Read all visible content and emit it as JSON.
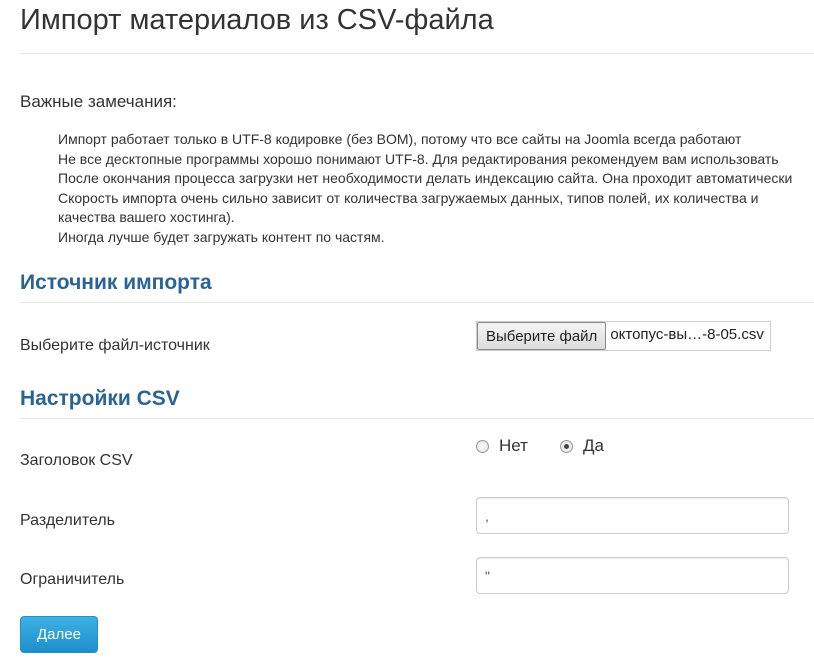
{
  "page": {
    "title": "Импорт материалов из CSV-файла"
  },
  "notes": {
    "heading": "Важные замечания:",
    "items": [
      "Импорт работает только в UTF-8 кодировке (без BOM), потому что все сайты на Joomla всегда работают",
      "Не все десктопные программы хорошо понимают UTF-8. Для редактирования рекомендуем вам использовать",
      "После окончания процесса загрузки нет необходимости делать индексацию сайта. Она проходит автоматически",
      "Скорость импорта очень сильно зависит от количества загружаемых данных, типов полей, их количества и"
    ],
    "item4_line2": "качества вашего хостинга).",
    "item4_line3": "Иногда лучше будет загружать контент по частям."
  },
  "source_section": {
    "title": "Источник импорта",
    "file_label": "Выберите файл-источник",
    "file_button": "Выберите файл",
    "file_name": "октопус-вы…-8-05.csv"
  },
  "csv_section": {
    "title": "Настройки CSV",
    "header_label": "Заголовок CSV",
    "radio_no": "Нет",
    "radio_yes": "Да",
    "selected": "yes",
    "delimiter_label": "Разделитель",
    "delimiter_value": ",",
    "enclosure_label": "Ограничитель",
    "enclosure_value": "\""
  },
  "actions": {
    "next_label": "Далее"
  },
  "colors": {
    "section_title": "#2a6496",
    "primary_button": "#2a9fd6",
    "rule": "#e5e5e5"
  }
}
